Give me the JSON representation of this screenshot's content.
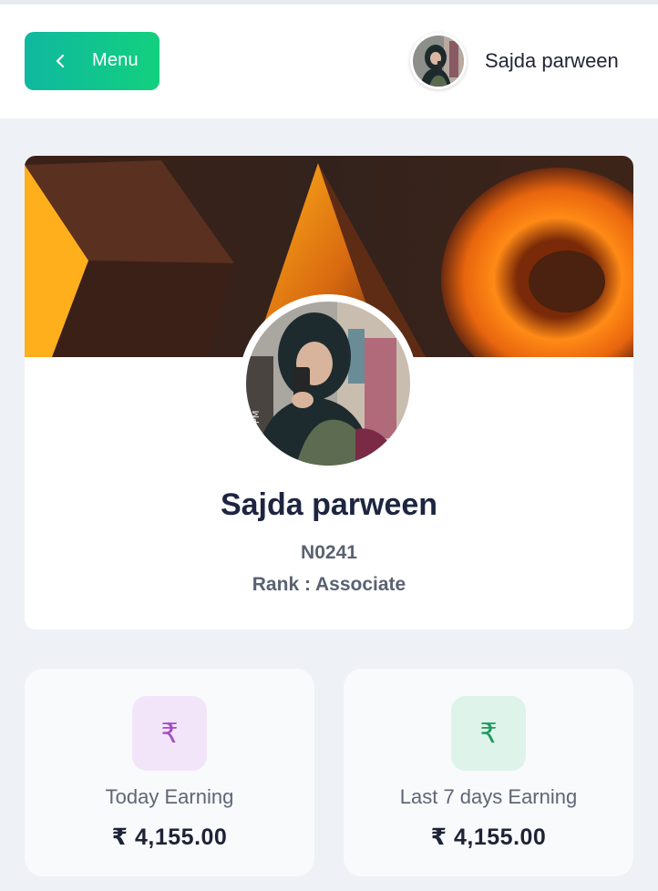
{
  "header": {
    "menu_label": "Menu",
    "user_name": "Sajda parween"
  },
  "profile": {
    "name": "Sajda parween",
    "member_id": "N0241",
    "rank": "Rank : Associate"
  },
  "stats": [
    {
      "icon": "₹",
      "label": "Today Earning",
      "value": "₹ 4,155.00",
      "accent": "#a44cc4"
    },
    {
      "icon": "₹",
      "label": "Last 7 days Earning",
      "value": "₹ 4,155.00",
      "accent": "#1b9a5d"
    }
  ],
  "colors": {
    "menu_gradient_start": "#0fb8a0",
    "menu_gradient_end": "#12d07e",
    "page_background": "#eef1f6"
  }
}
